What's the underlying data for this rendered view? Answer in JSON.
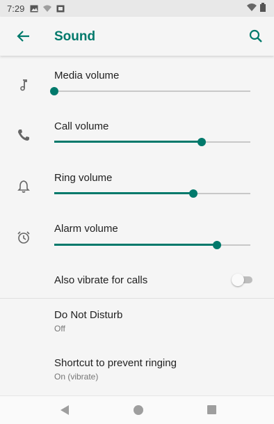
{
  "status_bar": {
    "time": "7:29",
    "icons": [
      "image-icon",
      "notification-icon",
      "screenshot-icon"
    ],
    "right_icons": [
      "wifi-icon",
      "battery-icon"
    ]
  },
  "app_bar": {
    "title": "Sound",
    "back_icon": "arrow-back-icon",
    "search_icon": "search-icon"
  },
  "volumes": [
    {
      "label": "Media volume",
      "icon": "music-note-icon",
      "level": 0.0
    },
    {
      "label": "Call volume",
      "icon": "phone-icon",
      "level": 0.75
    },
    {
      "label": "Ring volume",
      "icon": "bell-icon",
      "level": 0.71
    },
    {
      "label": "Alarm volume",
      "icon": "alarm-clock-icon",
      "level": 0.83
    }
  ],
  "vibrate": {
    "label": "Also vibrate for calls",
    "on": false
  },
  "dnd": {
    "title": "Do Not Disturb",
    "summary": "Off"
  },
  "shortcut": {
    "title": "Shortcut to prevent ringing",
    "summary": "On (vibrate)"
  },
  "colors": {
    "accent": "#00796b",
    "track": "#c8c8c8",
    "background": "#f5f5f5"
  },
  "nav_bar": [
    "back-triangle-icon",
    "home-circle-icon",
    "recents-square-icon"
  ]
}
